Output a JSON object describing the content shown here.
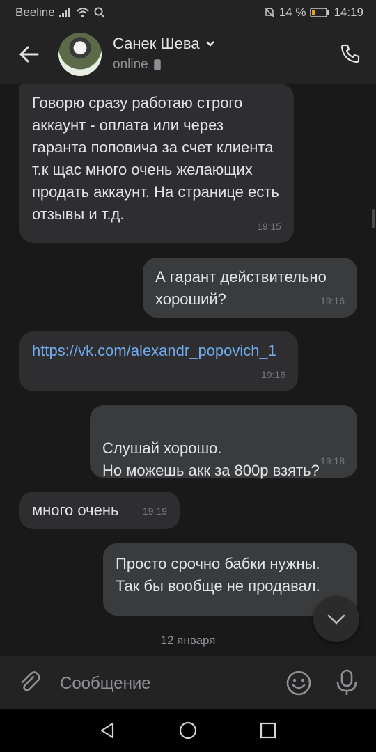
{
  "statusbar": {
    "carrier": "Beeline",
    "battery": "14 %",
    "time": "14:19"
  },
  "header": {
    "name": "Санек Шева",
    "status": "online"
  },
  "messages": [
    {
      "dir": "in",
      "text": "Говорю сразу работаю строго аккаунт - оплата или через гаранта поповича за счет клиента т.к щас много очень желающих продать аккаунт. На странице есть отзывы и т.д.",
      "time": "19:15"
    },
    {
      "dir": "out",
      "text": "А гарант действительно хороший?",
      "time": "19:16"
    },
    {
      "dir": "in",
      "text": "https://vk.com/alexandr_popovich_1",
      "time": "19:16"
    },
    {
      "dir": "out",
      "text": "Слушай хорошо.\nНо можешь акк за 800р взять?",
      "time": "19:18"
    },
    {
      "dir": "in",
      "text": "много очень",
      "time": "19:19"
    },
    {
      "dir": "out",
      "text": "Просто срочно бабки нужны. Так бы вообще не продавал.",
      "time": ""
    }
  ],
  "date_separator": "12 января",
  "composer": {
    "placeholder": "Сообщение"
  },
  "icons": {
    "back": "arrow-left-icon",
    "call": "phone-icon",
    "attach": "paperclip-icon",
    "emoji": "smile-icon",
    "mic": "microphone-icon",
    "scroll_down": "chevron-down-icon"
  }
}
